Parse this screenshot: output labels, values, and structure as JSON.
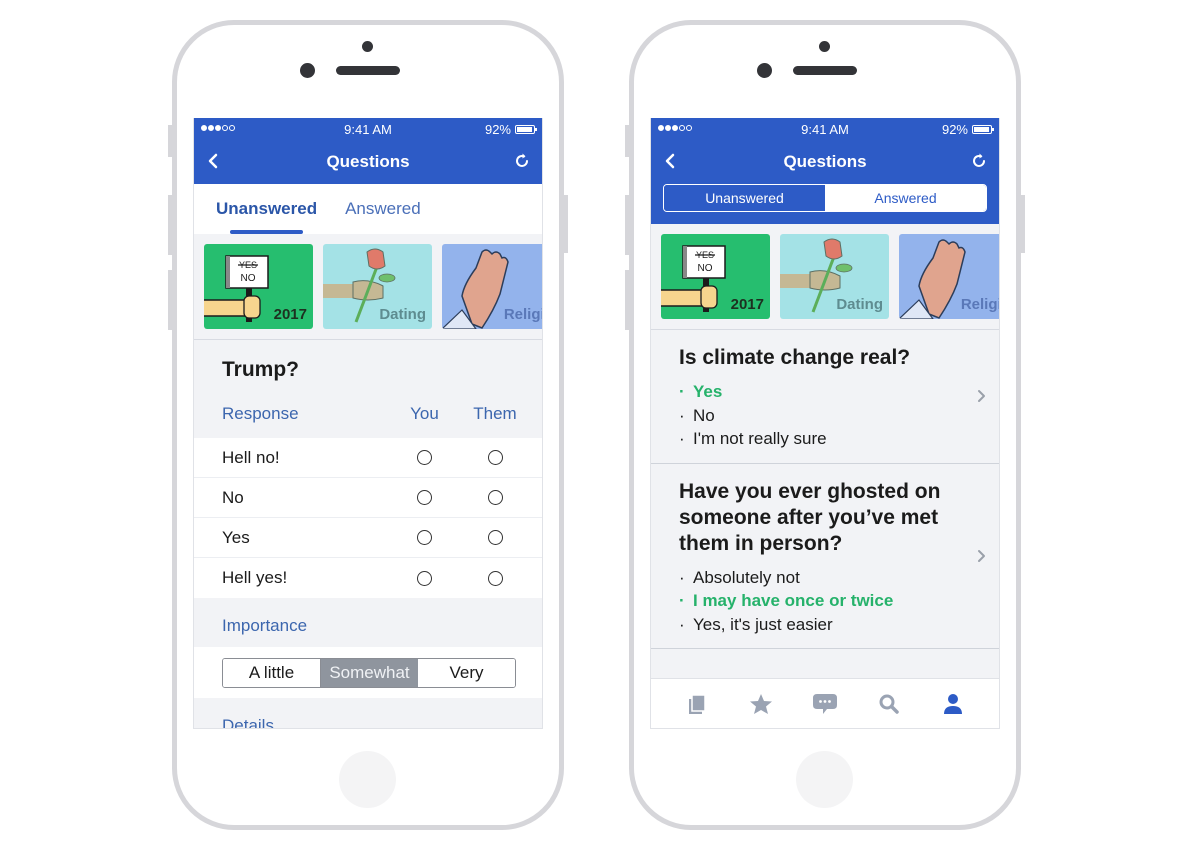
{
  "colors": {
    "brand_blue": "#2d5bc6",
    "accent_green": "#26b26b",
    "link_blue": "#3c66ae",
    "icon_gray": "#9aa3b3"
  },
  "left_phone": {
    "status_bar": {
      "signal_bars_filled": 3,
      "signal_bars_total": 5,
      "time": "9:41 AM",
      "battery_percent": "92%"
    },
    "nav": {
      "title": "Questions",
      "back_icon": "chevron-left-icon",
      "refresh_icon": "refresh-icon"
    },
    "tabs": [
      {
        "label": "Unanswered",
        "active": true
      },
      {
        "label": "Answered",
        "active": false
      }
    ],
    "categories": [
      {
        "label": "2017",
        "icon": "protest-sign-illustration"
      },
      {
        "label": "Dating",
        "icon": "rose-illustration"
      },
      {
        "label": "Religion",
        "icon": "praying-hands-illustration"
      }
    ],
    "question": {
      "title": "Trump?",
      "header": {
        "response": "Response",
        "you": "You",
        "them": "Them"
      },
      "responses": [
        {
          "label": "Hell no!"
        },
        {
          "label": "No"
        },
        {
          "label": "Yes"
        },
        {
          "label": "Hell yes!"
        }
      ],
      "importance_label": "Importance",
      "importance_options": [
        {
          "label": "A little",
          "selected": false
        },
        {
          "label": "Somewhat",
          "selected": true
        },
        {
          "label": "Very",
          "selected": false
        }
      ],
      "details_label": "Details"
    }
  },
  "right_phone": {
    "status_bar": {
      "signal_bars_filled": 3,
      "signal_bars_total": 5,
      "time": "9:41 AM",
      "battery_percent": "92%"
    },
    "nav": {
      "title": "Questions",
      "back_icon": "chevron-left-icon",
      "refresh_icon": "refresh-icon"
    },
    "segmented": [
      {
        "label": "Unanswered",
        "active": false
      },
      {
        "label": "Answered",
        "active": true
      }
    ],
    "categories": [
      {
        "label": "2017",
        "icon": "protest-sign-illustration"
      },
      {
        "label": "Dating",
        "icon": "rose-illustration"
      },
      {
        "label": "Religion",
        "icon": "praying-hands-illustration"
      }
    ],
    "answered_questions": [
      {
        "question": "Is climate change real?",
        "options": [
          {
            "label": "Yes",
            "chosen": true
          },
          {
            "label": "No",
            "chosen": false
          },
          {
            "label": "I'm not really sure",
            "chosen": false
          }
        ]
      },
      {
        "question": "Have you ever ghosted on someone after you’ve met them in person?",
        "options": [
          {
            "label": "Absolutely not",
            "chosen": false
          },
          {
            "label": "I may have once or twice",
            "chosen": true
          },
          {
            "label": "Yes, it's just easier",
            "chosen": false
          }
        ]
      }
    ],
    "tab_bar": [
      {
        "icon": "cards-icon",
        "active": false
      },
      {
        "icon": "star-icon",
        "active": false
      },
      {
        "icon": "chat-bubble-icon",
        "active": false
      },
      {
        "icon": "search-icon",
        "active": false
      },
      {
        "icon": "profile-icon",
        "active": true
      }
    ]
  }
}
